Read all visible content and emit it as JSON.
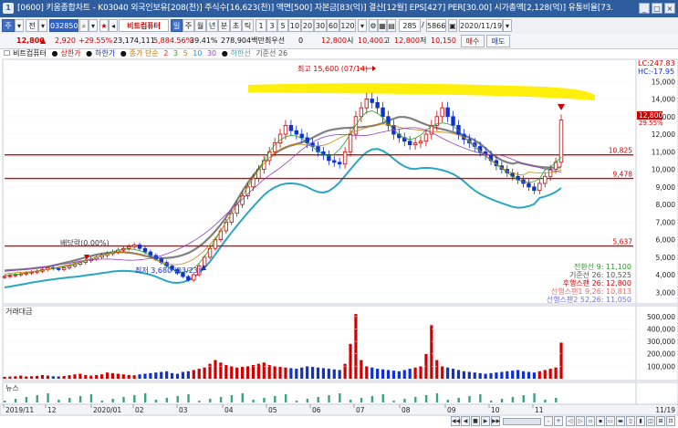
{
  "window": {
    "title": "[0600] 키움종합차트 - K03040 외국인보유[208(천)]  주식수[16,623(천)]  액면[500]  자본금[83(억)]  결산[12월]  EPS[427]  PER[30.00]  시가총액[2,128(억)]  유통비율[73.",
    "icon": "1"
  },
  "toolbar": {
    "tab_stock": "주",
    "tab_all": "전",
    "code": "032850",
    "stock_name": "비트컴퓨터",
    "btn_g": "일",
    "periods": [
      "주",
      "월",
      "년",
      "분",
      "초",
      "틱",
      "1",
      "3",
      "5",
      "10",
      "20",
      "30",
      "60",
      "120"
    ],
    "count": "285",
    "total": "5866",
    "date": "2020/11/19"
  },
  "infobar": {
    "price": "12,800",
    "change": "2,920",
    "change_rate": "+29.55%",
    "volume": "23,174,111",
    "vol_rate": "5,884.56%",
    "turnover": "39.41%",
    "amount": "278,904백만",
    "pref_label": "최우선",
    "pref_val": "0",
    "last": "12,800",
    "open_label": "시",
    "open": "10,400",
    "high_label": "고",
    "high": "12,800",
    "low_label": "저",
    "low": "10,150",
    "buy": "매수",
    "sell": "매도"
  },
  "legend": {
    "name": "비트컴퓨터",
    "upper": "상한가",
    "lower": "하한가",
    "close": "종가 단순",
    "ma": [
      "2",
      "3",
      "5",
      "10",
      "30"
    ],
    "limit": "하한선",
    "base": "기준선 26"
  },
  "corner": {
    "lc": "LC:247.83",
    "hc": "HC:-17.95"
  },
  "annotations": {
    "high": "최고 15,600 (07/14)",
    "low": "최저 3,680 (03/23)",
    "dividend": "배당락(0.00%)"
  },
  "lines": [
    {
      "label": "10,825",
      "value": 10825
    },
    {
      "label": "9,478",
      "value": 9478
    },
    {
      "label": "5,637",
      "value": 5637
    }
  ],
  "current_price_tag": {
    "label": "12,800",
    "rate": "29.55%"
  },
  "ichimoku": {
    "conversion": "전환선 9: 11,100",
    "base": "기준선 26: 10,525",
    "lagging": "후행스팬 26: 12,800",
    "span1": "선행스팬1 9,26: 10,813",
    "span2": "선행스팬2 52,26: 11,050"
  },
  "panels": {
    "volume_title": "거래대금",
    "news_title": "뉴스"
  },
  "price_axis": [
    "15,000",
    "14,000",
    "13,000",
    "12,000",
    "11,000",
    "10,000",
    "9,000",
    "8,000",
    "7,000",
    "6,000",
    "5,000",
    "4,000",
    "3,000"
  ],
  "volume_axis": [
    "500,000",
    "400,000",
    "300,000",
    "200,000",
    "100,000"
  ],
  "x_axis": [
    "2019/11",
    "12",
    "2020/01",
    "02",
    "03",
    "04",
    "05",
    "06",
    "07",
    "08",
    "09",
    "10",
    "11"
  ],
  "x_end": "11/19",
  "nav": [
    "◀◀",
    "◀",
    "■",
    "▶",
    "▶▶",
    "-",
    "+",
    "◁",
    "▷"
  ],
  "colors": {
    "title_bg": "#2d5d9e",
    "up": "#d00000",
    "down": "#1030d0",
    "cloud": "#2aa7c0",
    "gray_line": "#808080",
    "highlight": "#ffee00",
    "hline": "#e00000"
  },
  "chart_data": {
    "type": "candlestick",
    "ylim": [
      2500,
      16000
    ],
    "ticks": [
      3000,
      4000,
      5000,
      6000,
      7000,
      8000,
      9000,
      10000,
      11000,
      12000,
      13000,
      14000,
      15000
    ],
    "close": [
      3900,
      3950,
      4000,
      4050,
      4100,
      4150,
      4200,
      4300,
      4400,
      4350,
      4300,
      4400,
      4500,
      4600,
      4700,
      4800,
      4900,
      5000,
      5100,
      5200,
      5300,
      5400,
      5500,
      5600,
      5700,
      5500,
      5300,
      5100,
      4900,
      4700,
      4500,
      4300,
      4100,
      3900,
      3700,
      4000,
      4500,
      5000,
      5500,
      6000,
      6500,
      7000,
      7500,
      8000,
      8500,
      9000,
      9500,
      10000,
      10500,
      11000,
      11500,
      12000,
      12500,
      12200,
      12000,
      11800,
      11500,
      11300,
      11000,
      10800,
      10500,
      10400,
      10300,
      11000,
      12000,
      13000,
      13500,
      14000,
      13800,
      13500,
      13000,
      12500,
      12000,
      11800,
      11600,
      11400,
      11500,
      11600,
      12000,
      12500,
      13000,
      13500,
      13000,
      12500,
      12000,
      11700,
      11500,
      11300,
      11000,
      10800,
      10500,
      10200,
      10000,
      9800,
      9600,
      9400,
      9200,
      9000,
      8800,
      9200,
      9600,
      10000,
      10400,
      12800
    ],
    "volume": [
      15,
      18,
      20,
      25,
      18,
      20,
      22,
      30,
      25,
      20,
      18,
      22,
      28,
      35,
      40,
      30,
      25,
      30,
      35,
      50,
      45,
      40,
      35,
      30,
      28,
      35,
      40,
      45,
      50,
      55,
      60,
      45,
      40,
      55,
      60,
      70,
      80,
      90,
      120,
      150,
      130,
      110,
      100,
      90,
      95,
      100,
      110,
      120,
      130,
      110,
      100,
      95,
      90,
      85,
      80,
      90,
      100,
      95,
      90,
      85,
      80,
      75,
      70,
      120,
      280,
      520,
      150,
      100,
      90,
      80,
      75,
      70,
      65,
      60,
      70,
      80,
      90,
      100,
      200,
      430,
      150,
      100,
      90,
      80,
      70,
      60,
      55,
      50,
      45,
      40,
      45,
      50,
      55,
      60,
      65,
      70,
      60,
      55,
      50,
      60,
      70,
      80,
      90,
      290
    ]
  }
}
